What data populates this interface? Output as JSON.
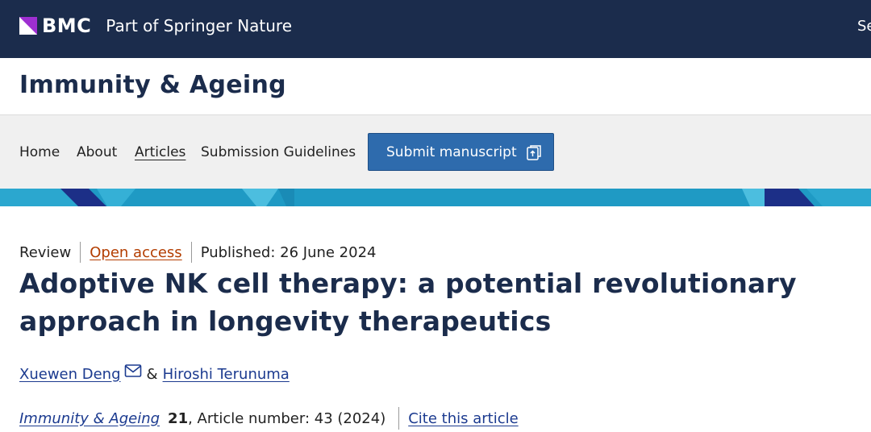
{
  "topbar": {
    "brand_name": "BMC",
    "brand_tagline": "Part of Springer Nature",
    "right_text": "Se",
    "background_color": "#1b2c4c"
  },
  "journal": {
    "title": "Immunity & Ageing"
  },
  "nav": {
    "items": [
      {
        "label": "Home",
        "active": false
      },
      {
        "label": "About",
        "active": false
      },
      {
        "label": "Articles",
        "active": true
      },
      {
        "label": "Submission Guidelines",
        "active": false
      }
    ],
    "submit_label": "Submit manuscript",
    "submit_icon": "external-link-icon",
    "submit_color": "#2e6bad"
  },
  "article": {
    "type": "Review",
    "access": "Open access",
    "published": "Published: 26 June 2024",
    "title": "Adoptive NK cell therapy: a potential revolutionary approach in longevity therapeutics",
    "authors": [
      {
        "name": "Xuewen Deng",
        "icon": "mail-icon"
      },
      {
        "name": "Hiroshi Terunuma"
      }
    ],
    "author_separator": "&",
    "citation": {
      "journal": "Immunity & Ageing",
      "volume": "21",
      "details": ", Article number: 43 (2024)",
      "cite_label": "Cite this article"
    }
  },
  "colors": {
    "title_navy": "#1b2c4c",
    "link_blue": "#1b3a8f",
    "open_access_orange": "#b33d00",
    "banner_teal": "#1f9ac4"
  }
}
